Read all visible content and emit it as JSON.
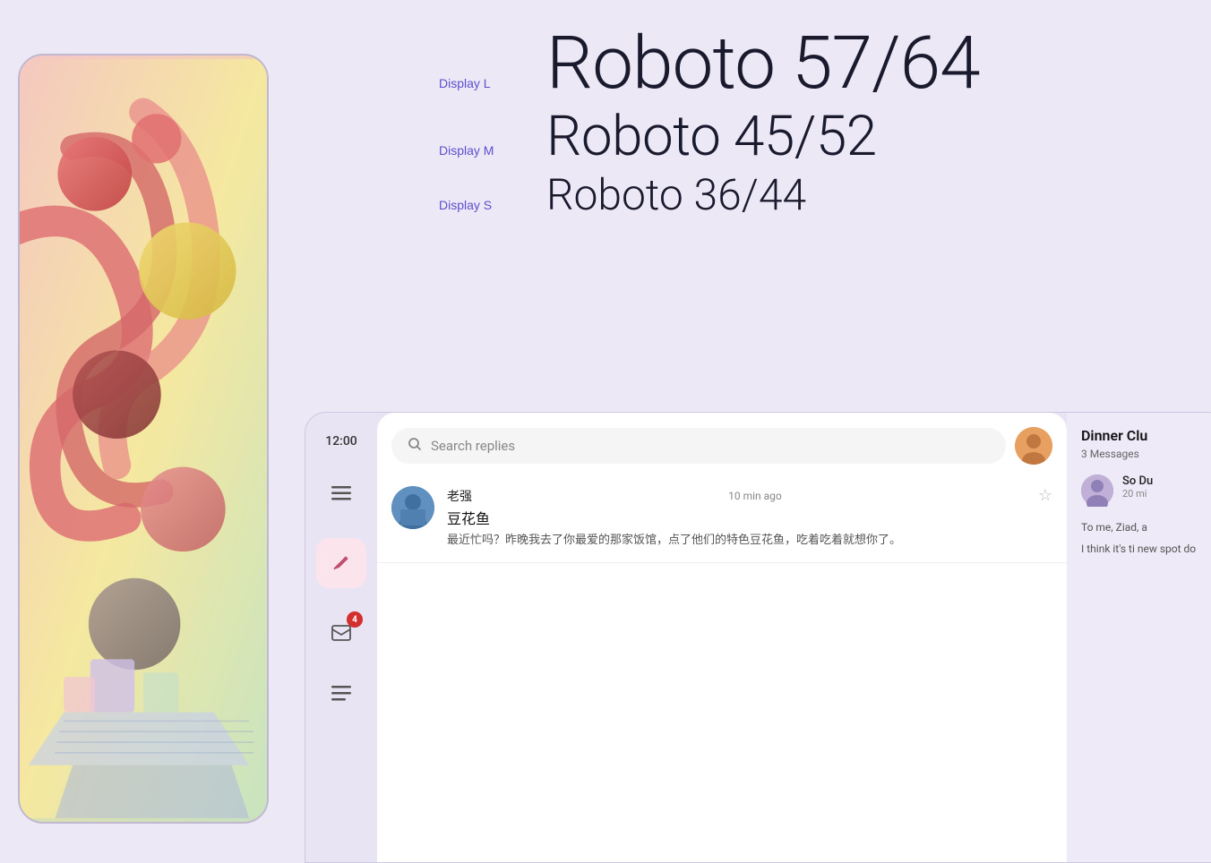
{
  "background_color": "#ede8f5",
  "left_panel": {
    "phone_art": "abstract colorful shapes with pinks, yellows, greens"
  },
  "type_scale": {
    "rows": [
      {
        "label": "Display L",
        "text": "Roboto 57/64",
        "size": "display-l"
      },
      {
        "label": "Display M",
        "text": "Roboto 45/52",
        "size": "display-m"
      },
      {
        "label": "Display S",
        "text": "Roboto 36/44",
        "size": "display-s"
      }
    ]
  },
  "ui_card": {
    "time": "12:00",
    "search_placeholder": "Search replies",
    "sidebar_icons": {
      "hamburger": "≡",
      "compose": "✏",
      "inbox_badge": "4",
      "list": "☰"
    },
    "email": {
      "sender": "老强",
      "time_ago": "10 min ago",
      "subject": "豆花鱼",
      "preview": "最近忙吗？昨晚我去了你最爱的那家饭馆，点了他们的特色豆花鱼，吃着吃着就想你了。"
    },
    "right_panel": {
      "thread_title": "Dinner Clu",
      "thread_messages": "3 Messages",
      "secondary_sender": "So Du",
      "secondary_time": "20 mi",
      "secondary_preview_1": "To me, Ziad, a",
      "secondary_preview_2": "I think it's ti new spot do"
    }
  }
}
